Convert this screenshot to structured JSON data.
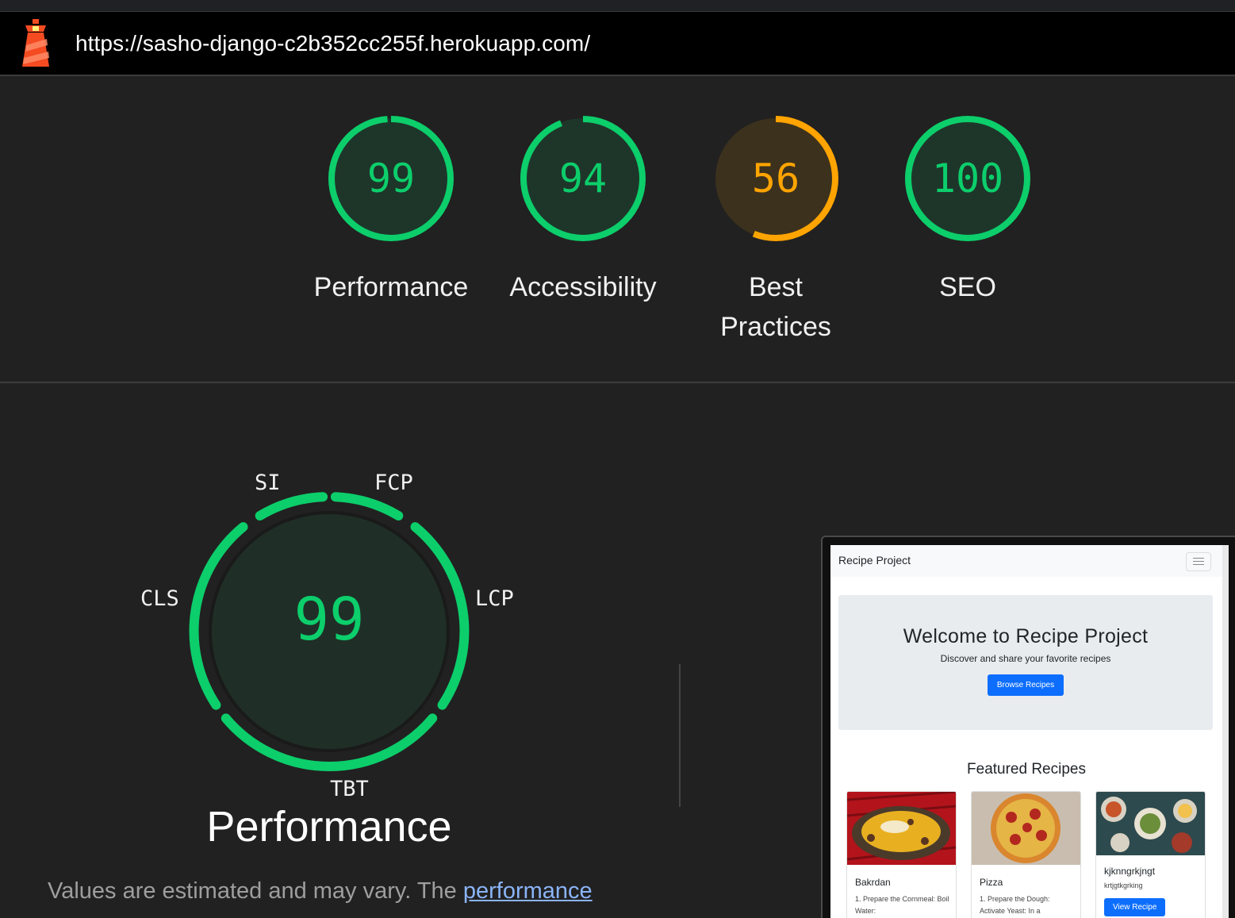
{
  "url": "https://sasho-django-c2b352cc255f.herokuapp.com/",
  "colors": {
    "pass": "#0cce6b",
    "average": "#ffa400",
    "fail": "#ff4e42",
    "link": "#8ab4f8"
  },
  "categories": [
    {
      "label": "Performance",
      "score": "99",
      "level": 0.99,
      "status": "pass"
    },
    {
      "label": "Accessibility",
      "score": "94",
      "level": 0.94,
      "status": "pass"
    },
    {
      "label": "Best Practices",
      "score": "56",
      "level": 0.56,
      "status": "average"
    },
    {
      "label": "SEO",
      "score": "100",
      "level": 1.0,
      "status": "pass"
    }
  ],
  "performance": {
    "score": "99",
    "title": "Performance",
    "metrics": {
      "si": "SI",
      "fcp": "FCP",
      "lcp": "LCP",
      "tbt": "TBT",
      "cls": "CLS"
    },
    "note_text": "Values are estimated and may vary. The ",
    "note_link": "performance"
  },
  "screenshot": {
    "brand": "Recipe Project",
    "hero_title": "Welcome to Recipe Project",
    "hero_subtitle": "Discover and share your favorite recipes",
    "hero_button": "Browse Recipes",
    "featured_heading": "Featured Recipes",
    "cards": [
      {
        "title": "Bakrdan",
        "text": "1. Prepare the Cornmeal: Boil Water:"
      },
      {
        "title": "Pizza",
        "text": "1. Prepare the Dough: Activate Yeast: In a"
      },
      {
        "title": "kjknngrkjngt",
        "text": "krtjgtkgrking",
        "button": "View Recipe"
      }
    ]
  }
}
